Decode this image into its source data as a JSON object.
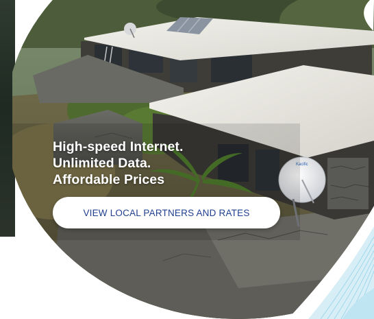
{
  "hero": {
    "headline_lines": [
      "High-speed Internet.",
      "Unlimited Data.",
      "Affordable Prices"
    ],
    "cta_label": "VIEW LOCAL PARTNERS AND RATES",
    "dish_brand": "Kacific"
  },
  "colors": {
    "cta_text": "#1f3f8f",
    "cta_background": "#ffffff",
    "headline_text": "#ffffff",
    "accent_wave": "#7fc9e6"
  }
}
